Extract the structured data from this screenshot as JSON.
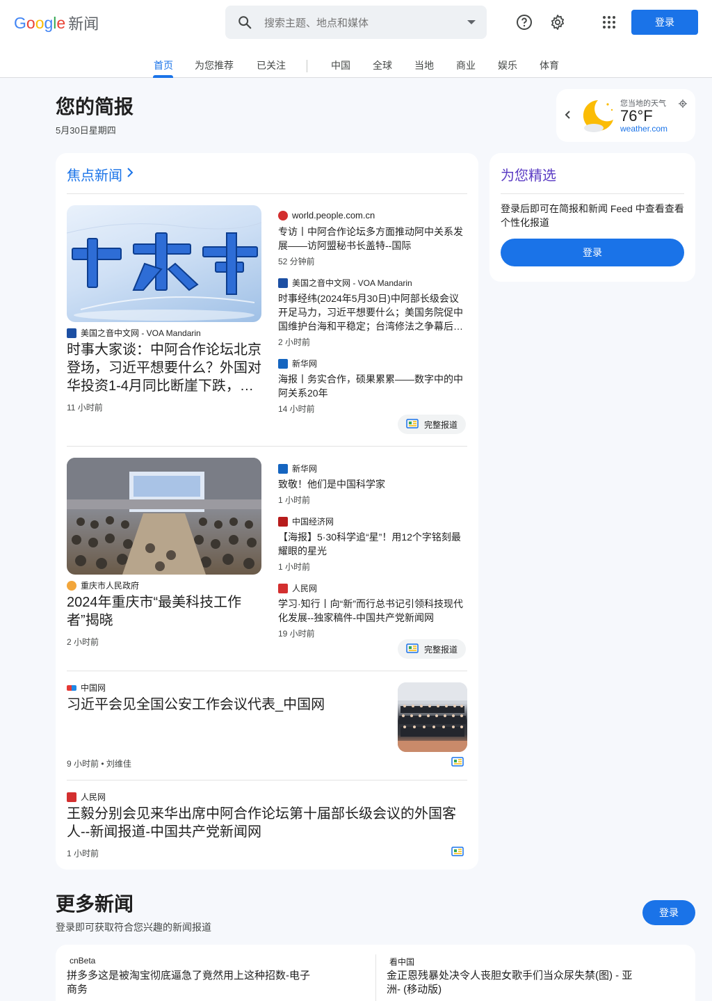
{
  "header": {
    "logo_letters": [
      "G",
      "o",
      "o",
      "g",
      "l",
      "e"
    ],
    "logo_suffix": "新闻",
    "search_placeholder": "搜索主题、地点和媒体",
    "signin_label": "登录",
    "icons": [
      "search-icon",
      "chevron-down-icon",
      "help-icon",
      "gear-icon",
      "apps-icon"
    ]
  },
  "tabs": [
    {
      "label": "首页",
      "active": true
    },
    {
      "label": "为您推荐"
    },
    {
      "label": "已关注"
    },
    {
      "label": "中国"
    },
    {
      "label": "全球"
    },
    {
      "label": "当地"
    },
    {
      "label": "商业"
    },
    {
      "label": "娱乐"
    },
    {
      "label": "体育"
    }
  ],
  "briefing": {
    "title": "您的简报",
    "date": "5月30日星期四"
  },
  "weather": {
    "label": "您当地的天气",
    "temp": "76°F",
    "source": "weather.com"
  },
  "top_stories": {
    "heading": "焦点新闻",
    "full_coverage_label": "完整报道",
    "cluster1": {
      "main": {
        "source": "美国之音中文网 - VOA Mandarin",
        "title": "时事大家谈：中阿合作论坛北京登场，习近平想要什么？外国对华投资1-4月同比断崖下跌，…",
        "time": "11 小时前",
        "image_text": "事大家"
      },
      "related": [
        {
          "source": "world.people.com.cn",
          "title": "专访丨中阿合作论坛多方面推动阿中关系发展——访阿盟秘书长盖特--国际",
          "time": "52 分钟前"
        },
        {
          "source": "美国之音中文网 - VOA Mandarin",
          "title": "时事经纬(2024年5月30日)中阿部长级会议开足马力，习近平想要什么；美国务院促中国维护台海和平稳定；台湾修法之争幕后…",
          "time": "2 小时前"
        },
        {
          "source": "新华网",
          "title": "海报丨务实合作，硕果累累——数字中的中阿关系20年",
          "time": "14 小时前"
        }
      ]
    },
    "cluster2": {
      "main": {
        "source": "重庆市人民政府",
        "title": "2024年重庆市“最美科技工作者”揭晓",
        "time": "2 小时前"
      },
      "related": [
        {
          "source": "新华网",
          "title": "致敬！他们是中国科学家",
          "time": "1 小时前"
        },
        {
          "source": "中国经济网",
          "title": "【海报】5·30科学追“星”！用12个字铭刻最耀眼的星光",
          "time": "1 小时前"
        },
        {
          "source": "人民网",
          "title": "学习·知行丨向“新”而行总书记引领科技现代化发展--独家稿件-中国共产党新闻网",
          "time": "19 小时前"
        }
      ]
    },
    "story3": {
      "source": "中国网",
      "title": "习近平会见全国公安工作会议代表_中国网",
      "time": "9 小时前",
      "author": "刘维佳"
    },
    "story4": {
      "source": "人民网",
      "title": "王毅分别会见来华出席中阿合作论坛第十届部长级会议的外国客人--新闻报道-中国共产党新闻网",
      "time": "1 小时前"
    }
  },
  "picks": {
    "title": "为您精选",
    "text": "登录后即可在简报和新闻 Feed 中查看查看个性化报道",
    "button": "登录"
  },
  "more_news": {
    "title": "更多新闻",
    "subtitle": "登录即可获取符合您兴趣的新闻报道",
    "button": "登录",
    "items": [
      {
        "source": "cnBeta",
        "title": "拼多多这是被淘宝彻底逼急了竟然用上这种招数-电子商务"
      },
      {
        "source": "看中国",
        "title": "金正恩残暴处决令人丧胆女歌手们当众尿失禁(图) - 亚洲- (移动版)"
      }
    ]
  },
  "colors": {
    "accent": "#1a73e8",
    "picks_title": "#5b3cc4",
    "background": "#f6f8fc"
  }
}
